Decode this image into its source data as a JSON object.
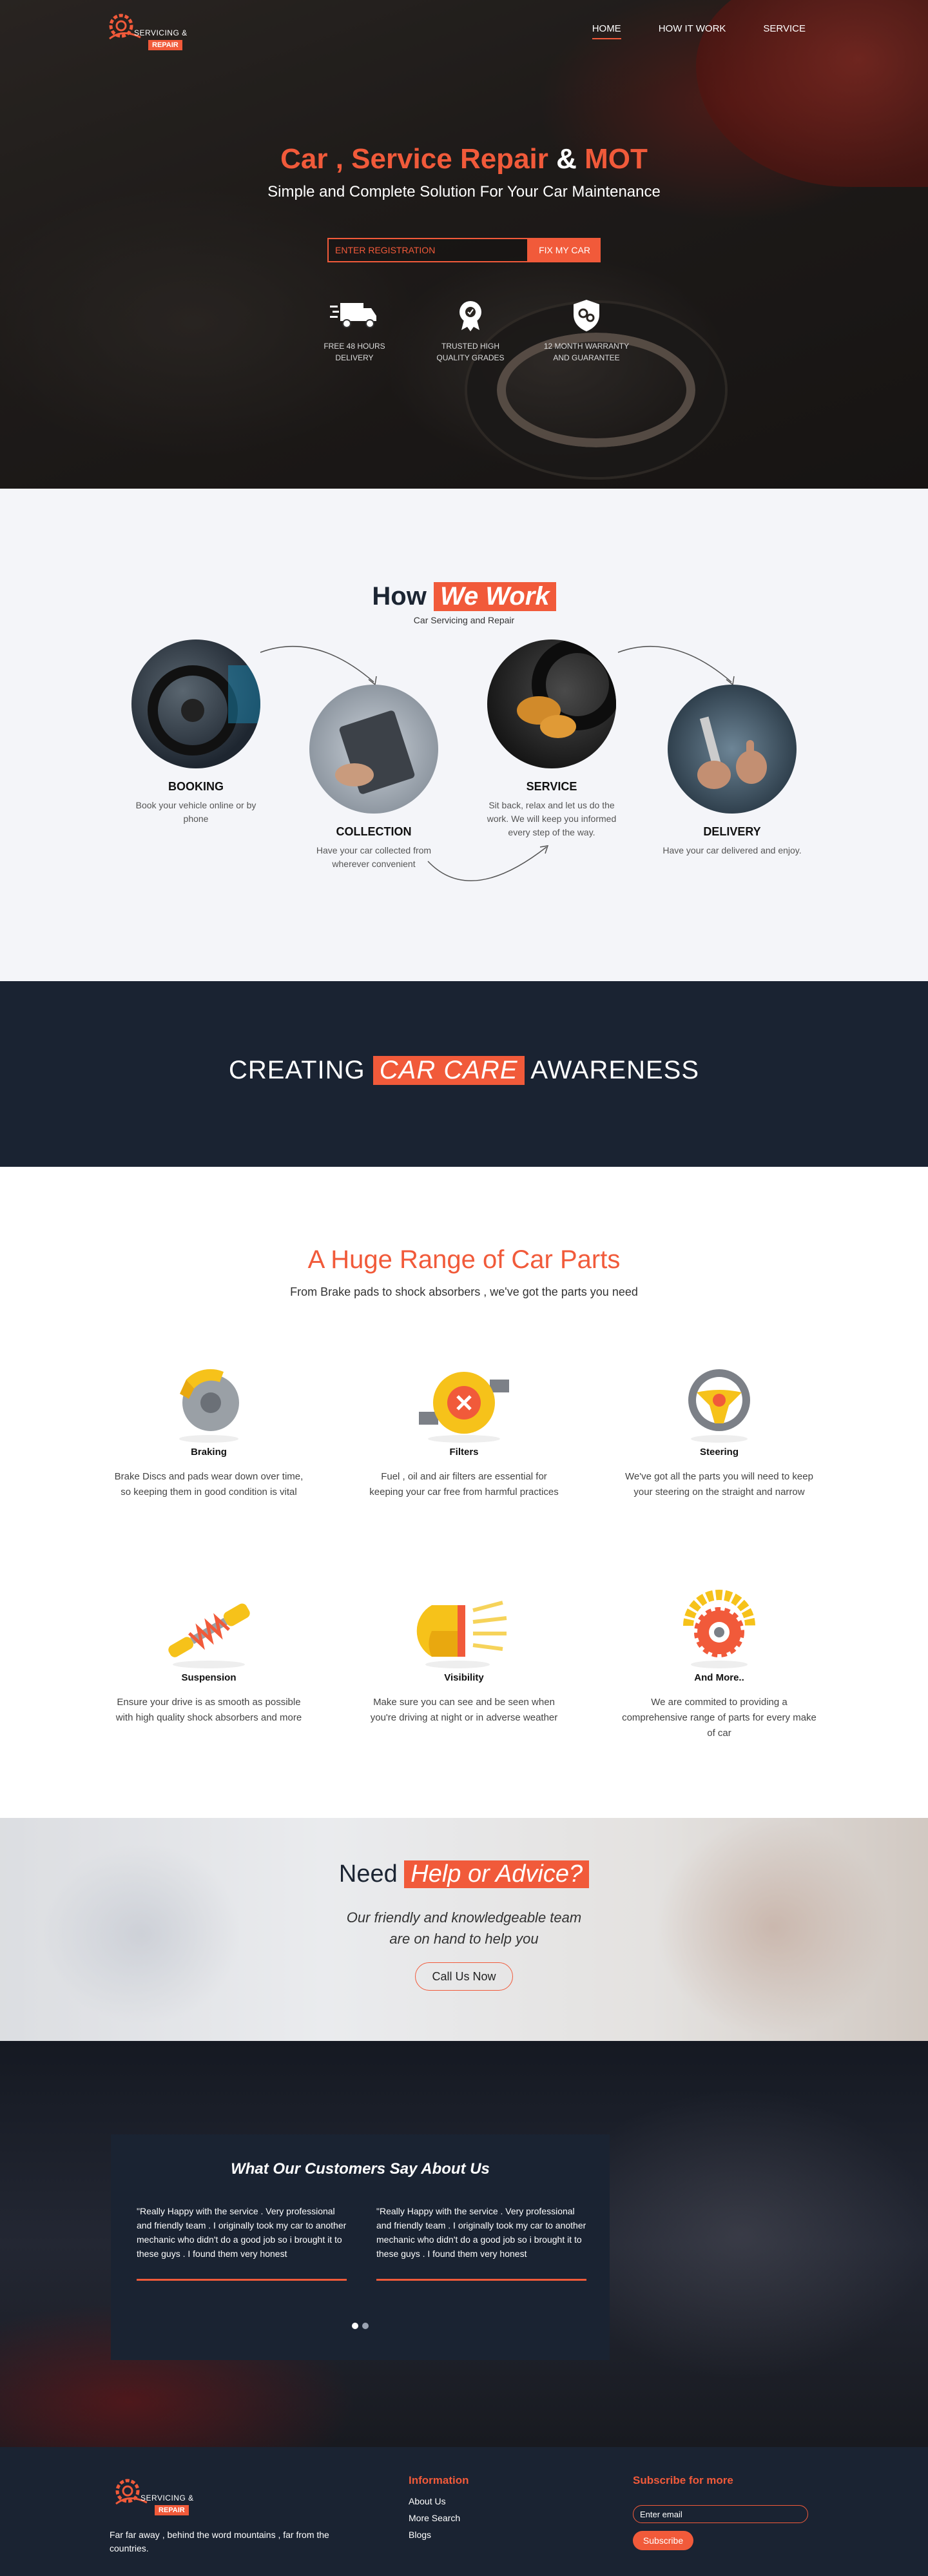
{
  "brand": {
    "name": "SERVICING &",
    "badge": "REPAIR"
  },
  "nav": [
    {
      "label": "HOME",
      "active": true
    },
    {
      "label": "HOW IT WORK",
      "active": false
    },
    {
      "label": "SERVICE",
      "active": false
    }
  ],
  "hero": {
    "title_part1": "Car , Service Repair",
    "title_amp": " & ",
    "title_part2": "MOT",
    "subtitle": "Simple and Complete Solution For Your Car Maintenance",
    "registration_placeholder": "ENTER REGISTRATION",
    "fix_button": "FIX MY CAR",
    "features": [
      {
        "icon": "delivery-truck-icon",
        "label": "FREE 48 HOURS DELIVERY"
      },
      {
        "icon": "quality-award-icon",
        "label": "TRUSTED HIGH QUALITY GRADES"
      },
      {
        "icon": "warranty-shield-icon",
        "label": "12 MONTH WARRANTY AND GUARANTEE"
      }
    ]
  },
  "how_we_work": {
    "title_plain": "How",
    "title_tag": "We Work",
    "subtitle": "Car Servicing and Repair",
    "steps": [
      {
        "title": "BOOKING",
        "text": "Book your vehicle online or by phone"
      },
      {
        "title": "COLLECTION",
        "text": "Have your car collected from wherever convenient"
      },
      {
        "title": "SERVICE",
        "text": "Sit back, relax and let us do the work. We will keep you informed every step of the way."
      },
      {
        "title": "DELIVERY",
        "text": "Have your car delivered and enjoy."
      }
    ]
  },
  "awareness": {
    "before": "CREATING",
    "tag": "CAR CARE",
    "after": "AWARENESS"
  },
  "parts": {
    "title": "A Huge Range of Car Parts",
    "subtitle": "From Brake pads to shock absorbers , we've got the parts you need",
    "items": [
      {
        "title": "Braking",
        "text": "Brake Discs and pads wear down over time, so keeping them in good condition is vital"
      },
      {
        "title": "Filters",
        "text": "Fuel , oil and air filters are essential for keeping your car free from harmful practices"
      },
      {
        "title": "Steering",
        "text": "We've got all the parts you will need to keep your steering on the straight and narrow"
      },
      {
        "title": "Suspension",
        "text": "Ensure your drive is as smooth as possible with high quality shock absorbers and more"
      },
      {
        "title": "Visibility",
        "text": "Make sure you can see and be seen when you're driving at night or in adverse weather"
      },
      {
        "title": "And More..",
        "text": "We are commited to providing a comprehensive range of parts for every make of car"
      }
    ]
  },
  "help": {
    "title_plain": "Need",
    "title_tag": "Help or Advice?",
    "line1": "Our friendly and knowledgeable team",
    "line2": "are on hand to help you",
    "button": "Call Us Now"
  },
  "testimonials": {
    "title": "What Our Customers Say About Us",
    "quotes": [
      "\"Really Happy with the service . Very professional and friendly team . I originally took my car to another mechanic who didn't do a good job so i brought it to these guys . I found them very honest",
      "\"Really Happy with the service . Very professional and friendly team . I originally took my car to another mechanic who didn't do a good job so i brought it to these guys . I found them very honest"
    ]
  },
  "footer": {
    "about": "Far far away , behind the word mountains , far from the countries.",
    "info_title": "Information",
    "links": [
      "About Us",
      "More Search",
      "Blogs"
    ],
    "subscribe_title": "Subscribe for more",
    "email_placeholder": "Enter email",
    "subscribe_button": "Subscribe"
  },
  "colors": {
    "accent": "#f15a3a",
    "navy": "#1a2332",
    "light": "#f4f5f9"
  }
}
